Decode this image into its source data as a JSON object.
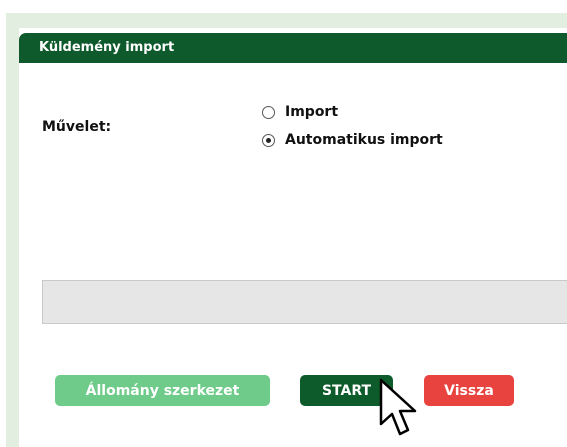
{
  "panel": {
    "title": "Küldemény import"
  },
  "form": {
    "operation_label": "Művelet:",
    "options": [
      {
        "label": "Import",
        "checked": false
      },
      {
        "label": "Automatikus import",
        "checked": true
      }
    ]
  },
  "buttons": {
    "structure_label": "Állomány szerkezet",
    "start_label": "START",
    "back_label": "Vissza"
  },
  "colors": {
    "header": "#0f5a2c",
    "start": "#0d5a2b",
    "structure": "#6fcb8a",
    "back": "#e8433f",
    "frame": "#e2efe0"
  },
  "icons": {
    "cursor": "mouse-pointer-icon"
  }
}
